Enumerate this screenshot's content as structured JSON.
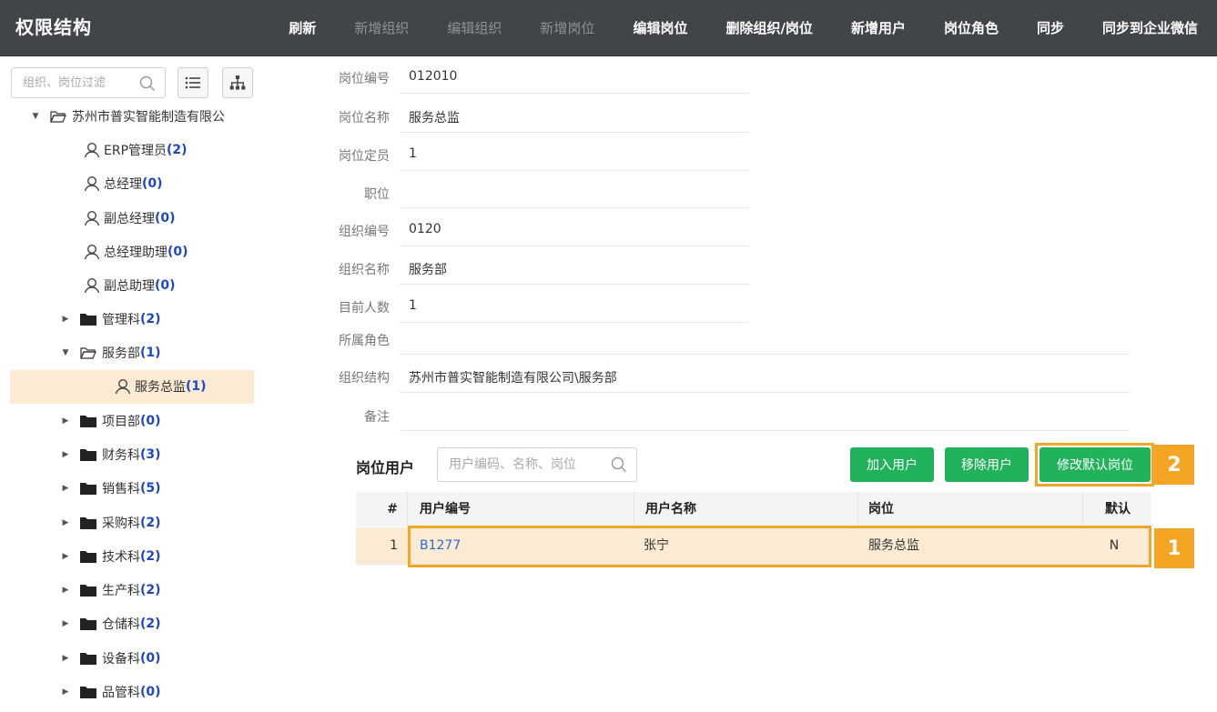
{
  "app": {
    "title": "权限结构"
  },
  "menu": [
    {
      "label": "刷新",
      "enabled": true
    },
    {
      "label": "新增组织",
      "enabled": false
    },
    {
      "label": "编辑组织",
      "enabled": false
    },
    {
      "label": "新增岗位",
      "enabled": false
    },
    {
      "label": "编辑岗位",
      "enabled": true
    },
    {
      "label": "删除组织/岗位",
      "enabled": true
    },
    {
      "label": "新增用户",
      "enabled": true
    },
    {
      "label": "岗位角色",
      "enabled": true
    },
    {
      "label": "同步",
      "enabled": true
    },
    {
      "label": "同步到企业微信",
      "enabled": true
    }
  ],
  "sidebar": {
    "search_placeholder": "组织、岗位过滤",
    "tree": [
      {
        "label": "苏州市普实智能制造有限公",
        "count": "",
        "type": "folder-open",
        "level": 0
      },
      {
        "label": "ERP管理员",
        "count": "(2)",
        "type": "person",
        "level": 1
      },
      {
        "label": "总经理",
        "count": "(0)",
        "type": "person",
        "level": 1
      },
      {
        "label": "副总经理",
        "count": "(0)",
        "type": "person",
        "level": 1
      },
      {
        "label": "总经理助理",
        "count": "(0)",
        "type": "person",
        "level": 1
      },
      {
        "label": "副总助理",
        "count": "(0)",
        "type": "person",
        "level": 1
      },
      {
        "label": "管理科",
        "count": "(2)",
        "type": "folder",
        "level": 1
      },
      {
        "label": "服务部",
        "count": "(1)",
        "type": "folder-open",
        "level": 1
      },
      {
        "label": "服务总监",
        "count": "(1)",
        "type": "person",
        "level": 2,
        "selected": true
      },
      {
        "label": "项目部",
        "count": "(0)",
        "type": "folder",
        "level": 1
      },
      {
        "label": "财务科",
        "count": "(3)",
        "type": "folder",
        "level": 1
      },
      {
        "label": "销售科",
        "count": "(5)",
        "type": "folder",
        "level": 1
      },
      {
        "label": "采购科",
        "count": "(2)",
        "type": "folder",
        "level": 1
      },
      {
        "label": "技术科",
        "count": "(2)",
        "type": "folder",
        "level": 1
      },
      {
        "label": "生产科",
        "count": "(2)",
        "type": "folder",
        "level": 1
      },
      {
        "label": "仓储科",
        "count": "(2)",
        "type": "folder",
        "level": 1
      },
      {
        "label": "设备科",
        "count": "(0)",
        "type": "folder",
        "level": 1
      },
      {
        "label": "品管科",
        "count": "(0)",
        "type": "folder",
        "level": 1
      }
    ]
  },
  "detail": {
    "fields": [
      {
        "label": "岗位编号",
        "value": "012010"
      },
      {
        "label": "岗位名称",
        "value": "服务总监"
      },
      {
        "label": "岗位定员",
        "value": "1"
      },
      {
        "label": "职位",
        "value": ""
      },
      {
        "label": "组织编号",
        "value": "0120"
      },
      {
        "label": "组织名称",
        "value": "服务部"
      },
      {
        "label": "目前人数",
        "value": "1"
      },
      {
        "label": "所属角色",
        "value": ""
      },
      {
        "label": "组织结构",
        "value": "苏州市普实智能制造有限公司\\服务部"
      },
      {
        "label": "备注",
        "value": ""
      }
    ]
  },
  "users": {
    "title": "岗位用户",
    "search_placeholder": "用户编码、名称、岗位",
    "buttons": {
      "add": "加入用户",
      "remove": "移除用户",
      "set_default": "修改默认岗位"
    },
    "columns": [
      "#",
      "用户编号",
      "用户名称",
      "岗位",
      "默认"
    ],
    "rows": [
      {
        "index": "1",
        "code": "B1277",
        "name": "张宁",
        "post": "服务总监",
        "default": "N"
      }
    ]
  },
  "annotations": {
    "badge1": "1",
    "badge2": "2"
  },
  "colors": {
    "topbar": "#414448",
    "accent_green": "#21b25b",
    "highlight": "#f5a524",
    "selected_bg": "#fcebd3",
    "count_blue": "#1d46c8"
  }
}
